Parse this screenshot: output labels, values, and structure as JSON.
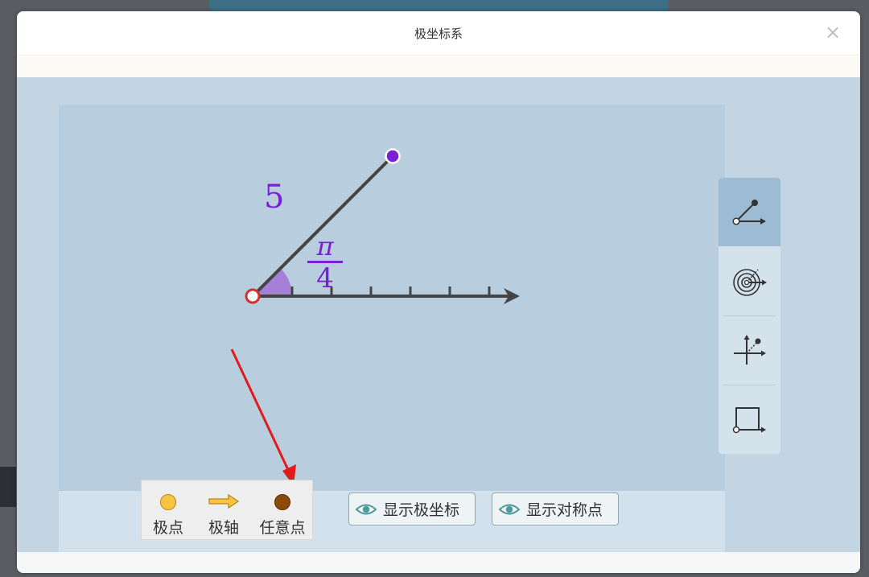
{
  "window": {
    "title": "极坐标系",
    "close_symbol": "×"
  },
  "diagram": {
    "radius_label": "5",
    "angle_numerator": "π",
    "angle_denominator": "4",
    "colors": {
      "point": "#7a1fd6",
      "angle_fill": "#a67fd8",
      "axis": "#444444",
      "pole_outline": "#d3322c"
    }
  },
  "legend": {
    "pole": {
      "label": "极点",
      "color": "#f6c343"
    },
    "axis": {
      "label": "极轴",
      "color": "#f6c343"
    },
    "any_point": {
      "label": "任意点",
      "color": "#8b4a07"
    }
  },
  "buttons": {
    "show_polar_coords": {
      "label": "显示极坐标",
      "icon": "eye-icon"
    },
    "show_symmetric_point": {
      "label": "显示对称点",
      "icon": "eye-icon"
    }
  },
  "toolbar": {
    "tools": [
      {
        "name": "polar-point-tool",
        "icon": "polar-angle-icon",
        "active": true
      },
      {
        "name": "polar-grid-tool",
        "icon": "polar-grid-icon",
        "active": false
      },
      {
        "name": "cartesian-tool",
        "icon": "cartesian-axes-icon",
        "active": false
      },
      {
        "name": "rectangle-tool",
        "icon": "rectangle-icon",
        "active": false
      }
    ]
  }
}
